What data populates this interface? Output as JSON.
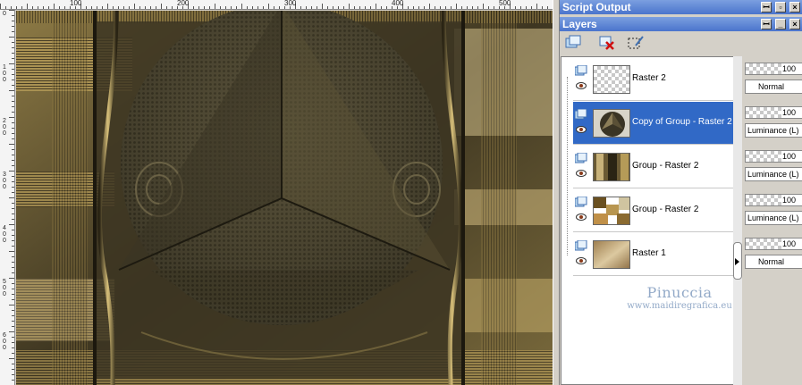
{
  "palettes": {
    "script_output": {
      "title": "Script Output"
    },
    "layers": {
      "title": "Layers"
    }
  },
  "layers_toolbar": {
    "tools": [
      {
        "name": "new-raster-layer",
        "icon": "new-layer-icon"
      },
      {
        "name": "delete-layer",
        "icon": "delete-layer-icon"
      },
      {
        "name": "edit-selection",
        "icon": "edit-selection-icon"
      }
    ]
  },
  "layers": [
    {
      "name": "Raster 2",
      "thumb": "checker",
      "selected": false,
      "opacity": "100",
      "blend": "Normal",
      "blend_centered": true
    },
    {
      "name": "Copy of Group - Raster 2",
      "thumb": "sphere",
      "selected": true,
      "opacity": "100",
      "blend": "Luminance (L)",
      "blend_centered": false
    },
    {
      "name": "Group - Raster 2",
      "thumb": "bars",
      "selected": false,
      "opacity": "100",
      "blend": "Luminance (L)",
      "blend_centered": false
    },
    {
      "name": "Group - Raster 2",
      "thumb": "mosaic",
      "selected": false,
      "opacity": "100",
      "blend": "Luminance (L)",
      "blend_centered": false
    },
    {
      "name": "Raster 1",
      "thumb": "gradient",
      "selected": false,
      "opacity": "100",
      "blend": "Normal",
      "blend_centered": true
    }
  ],
  "watermark": {
    "name": "Pinuccia",
    "url": "www.maidiregrafica.eu"
  },
  "rulers": {
    "top_labels": [
      "100",
      "200",
      "300",
      "400",
      "500",
      "600"
    ],
    "left_labels": [
      "0",
      "1 0 0",
      "2 0 0",
      "3 0 0",
      "4 0 0",
      "5 0 0",
      "6 0 0"
    ]
  },
  "colors": {
    "palette_title_bg": "#4a74cc",
    "selected_row": "#3169c6",
    "canvas_gold": "#b49a55",
    "canvas_dark": "#2a2414"
  }
}
